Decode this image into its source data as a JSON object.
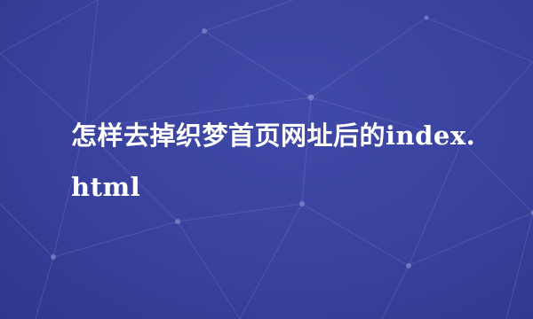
{
  "title": "怎样去掉织梦首页网址后的index.html"
}
